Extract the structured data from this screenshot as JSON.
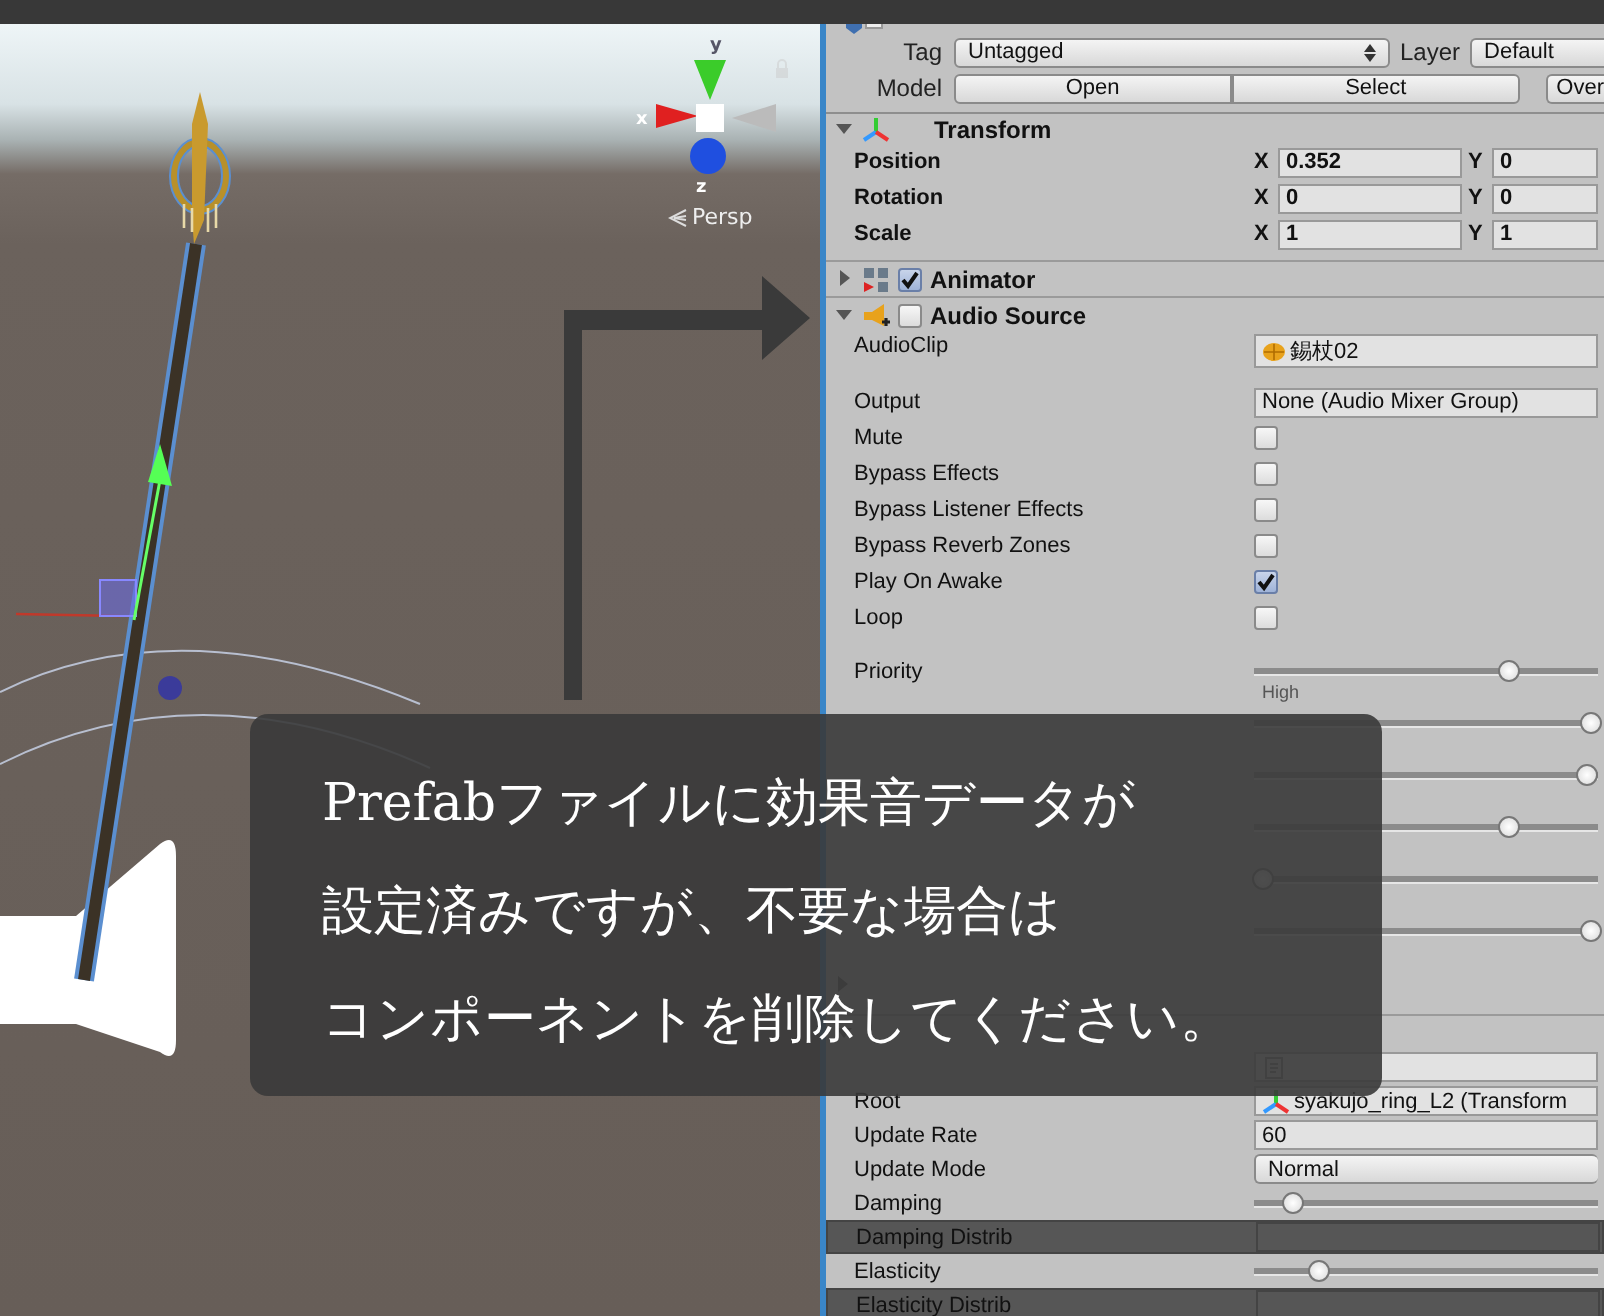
{
  "scene": {
    "gizmo_axes": [
      "y",
      "x",
      "z"
    ],
    "projection": "Persp"
  },
  "inspector": {
    "header": {
      "tag_label": "Tag",
      "tag": "Untagged",
      "layer_label": "Layer",
      "layer": "Default",
      "model_label": "Model",
      "model_buttons": [
        "Open",
        "Select",
        "Over"
      ]
    },
    "components": [
      {
        "name": "Transform",
        "expanded": true,
        "rows": [
          {
            "kind": "vector",
            "label": "Position",
            "values": [
              {
                "axis": "X",
                "value": "0.352"
              },
              {
                "axis": "Y",
                "value": "0"
              }
            ]
          },
          {
            "kind": "vector",
            "label": "Rotation",
            "values": [
              {
                "axis": "X",
                "value": "0"
              },
              {
                "axis": "Y",
                "value": "0"
              }
            ]
          },
          {
            "kind": "vector",
            "label": "Scale",
            "values": [
              {
                "axis": "X",
                "value": "1"
              },
              {
                "axis": "Y",
                "value": "1"
              }
            ]
          }
        ]
      },
      {
        "name": "Animator",
        "expanded": false,
        "enabled": true
      },
      {
        "name": "Audio Source",
        "expanded": true,
        "enabled": false,
        "rows": [
          {
            "kind": "object",
            "label": "AudioClip",
            "value": "錫杖02"
          },
          {
            "kind": "object",
            "label": "Output",
            "value": "None (Audio Mixer Group)"
          },
          {
            "kind": "checkbox",
            "label": "Mute",
            "checked": false
          },
          {
            "kind": "checkbox",
            "label": "Bypass Effects",
            "checked": false
          },
          {
            "kind": "checkbox",
            "label": "Bypass Listener Effects",
            "checked": false
          },
          {
            "kind": "checkbox",
            "label": "Bypass Reverb Zones",
            "checked": false
          },
          {
            "kind": "checkbox",
            "label": "Play On Awake",
            "checked": true
          },
          {
            "kind": "checkbox",
            "label": "Loop",
            "checked": false
          },
          {
            "kind": "audio-slider",
            "label": "Priority",
            "level": 0.75,
            "caption": "High"
          },
          {
            "kind": "audio-slider",
            "level": 1
          },
          {
            "kind": "audio-slider",
            "level": 0.99
          },
          {
            "kind": "audio-slider",
            "level": 0.75
          },
          {
            "kind": "audio-slider",
            "level": 0
          },
          {
            "kind": "audio-slider",
            "level": 1
          },
          {
            "kind": "foldout",
            "expanded": false
          }
        ]
      },
      {
        "expanded": true,
        "rows": [
          {
            "kind": "object",
            "disabled": true
          },
          {
            "kind": "object",
            "label": "Root",
            "value": "syakujo_ring_L2 (Transform"
          },
          {
            "kind": "text",
            "label": "Update Rate",
            "value": "60"
          },
          {
            "kind": "dropdown",
            "label": "Update Mode",
            "value": "Normal"
          },
          {
            "kind": "slider",
            "label": "Damping",
            "level": 0.09
          },
          {
            "kind": "curve",
            "label": "Damping Distrib"
          },
          {
            "kind": "slider",
            "label": "Elasticity",
            "level": 0.17
          },
          {
            "kind": "curve",
            "label": "Elasticity Distrib"
          }
        ]
      }
    ]
  },
  "caption": {
    "lines": [
      "Prefabファイルに効果音データが",
      "設定済みですが、不要な場合は",
      "コンポーネントを削除してください。"
    ]
  }
}
